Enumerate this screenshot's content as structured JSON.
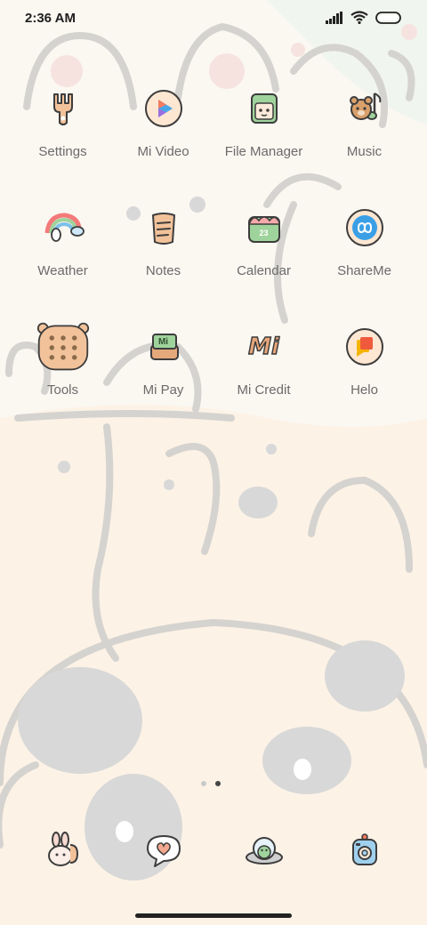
{
  "status_bar": {
    "time": "2:36 AM",
    "icons": [
      "signal-icon",
      "wifi-icon",
      "battery-icon"
    ]
  },
  "apps": [
    {
      "label": "Settings",
      "icon": "settings-icon"
    },
    {
      "label": "Mi Video",
      "icon": "mi-video-icon"
    },
    {
      "label": "File Manager",
      "icon": "file-manager-icon"
    },
    {
      "label": "Music",
      "icon": "music-icon"
    },
    {
      "label": "Weather",
      "icon": "weather-icon"
    },
    {
      "label": "Notes",
      "icon": "notes-icon"
    },
    {
      "label": "Calendar",
      "icon": "calendar-icon",
      "badge": "23"
    },
    {
      "label": "ShareMe",
      "icon": "shareme-icon"
    },
    {
      "label": "Tools",
      "icon": "tools-folder-icon"
    },
    {
      "label": "Mi Pay",
      "icon": "mi-pay-icon",
      "glyph": "Mi"
    },
    {
      "label": "Mi Credit",
      "icon": "mi-credit-icon",
      "glyph": "Mi"
    },
    {
      "label": "Helo",
      "icon": "helo-icon"
    }
  ],
  "page_indicator": {
    "total": 2,
    "active": 2
  },
  "dock": [
    {
      "icon": "phone-bunny-icon"
    },
    {
      "icon": "messages-heart-icon"
    },
    {
      "icon": "browser-dino-icon"
    },
    {
      "icon": "camera-icon"
    }
  ],
  "colors": {
    "background": "#fbf7f1",
    "label": "#6b6b6b",
    "outline": "#3d3d3d",
    "peach": "#f2c29a",
    "green": "#9fd39c",
    "blue": "#4aa6e8"
  }
}
